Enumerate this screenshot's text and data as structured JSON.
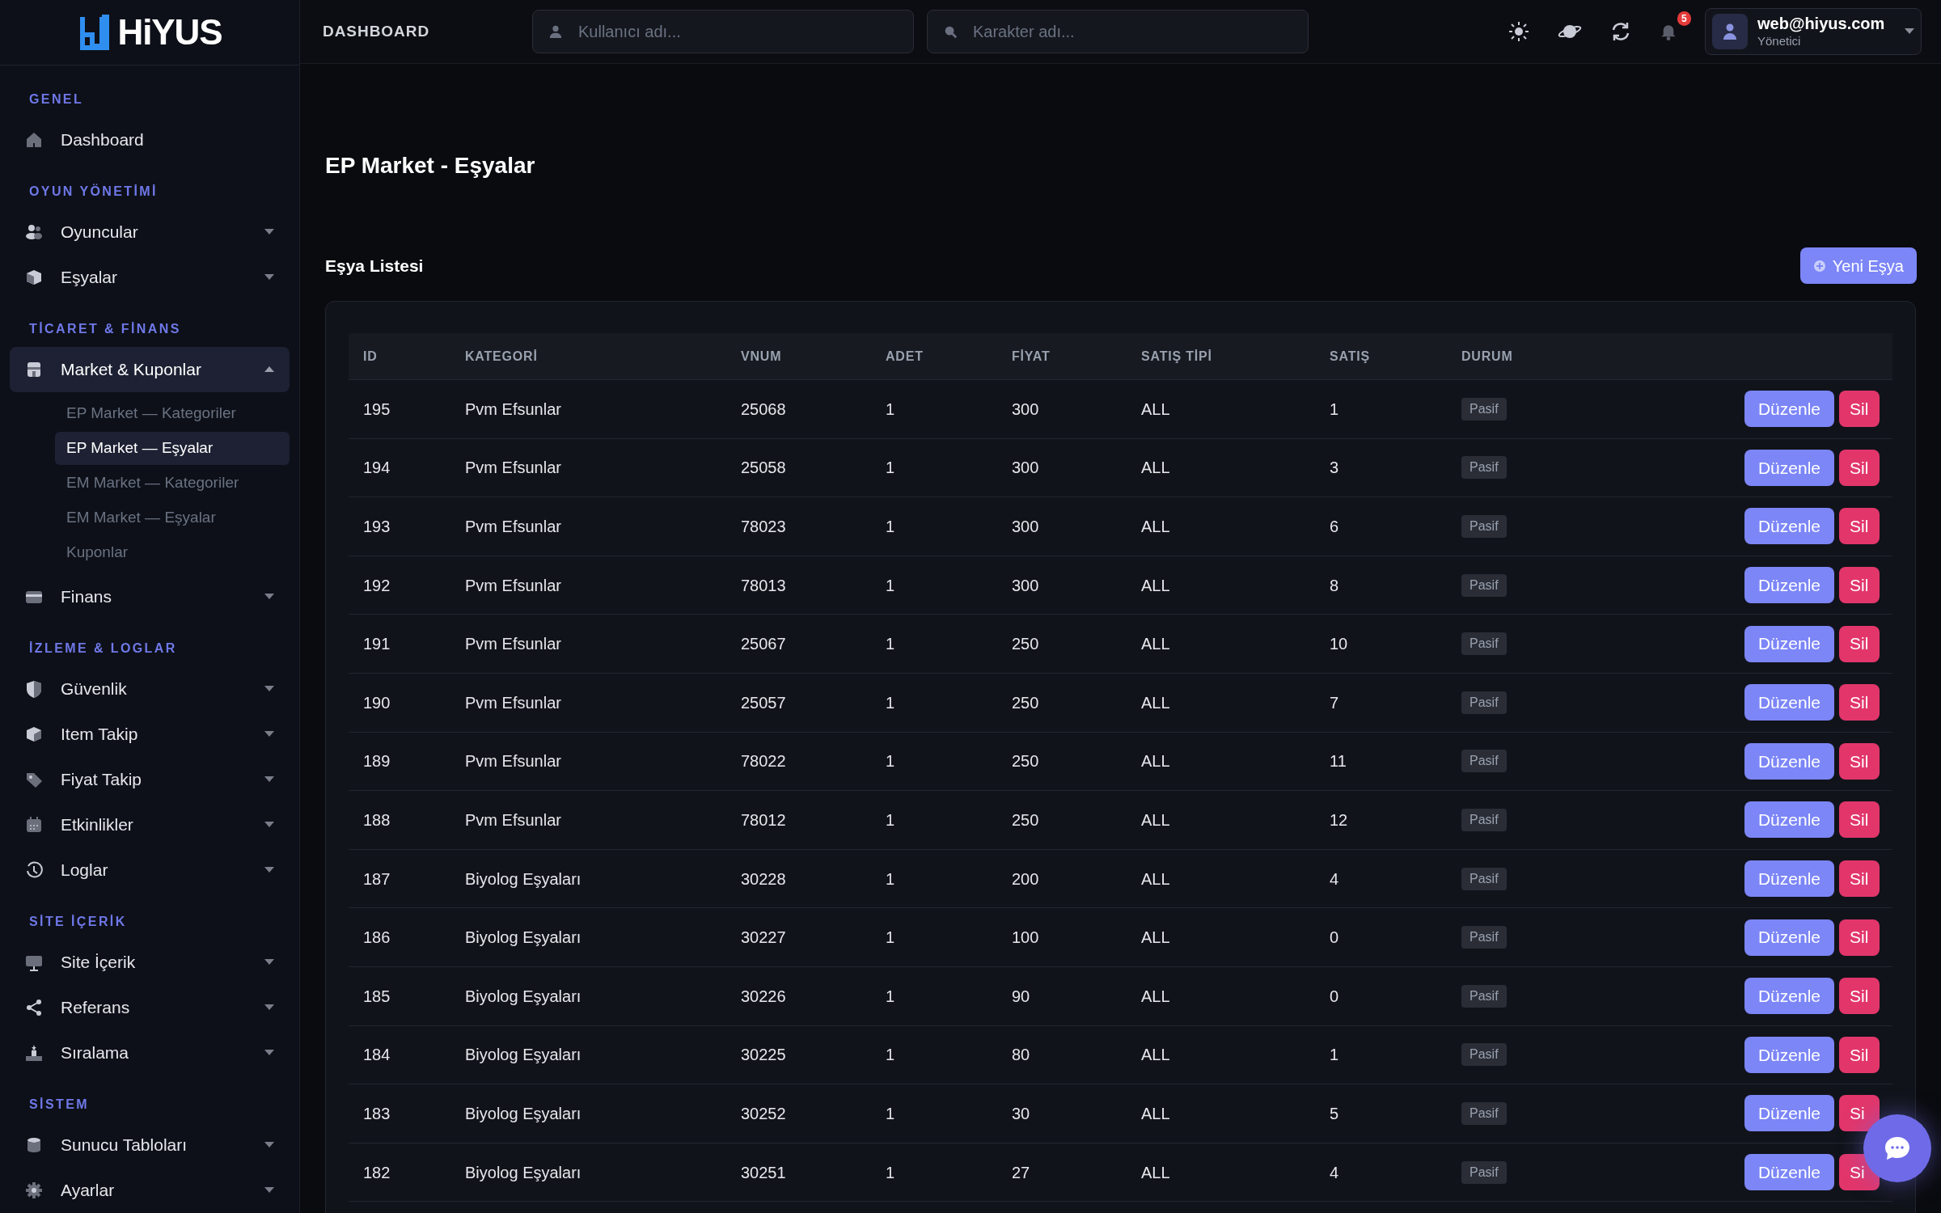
{
  "logo": {
    "text": "HiYUS"
  },
  "topbar": {
    "title": "DASHBOARD",
    "search_user": {
      "placeholder": "Kullanıcı adı..."
    },
    "search_char": {
      "placeholder": "Karakter adı..."
    },
    "notifications": "5",
    "user": {
      "email": "web@hiyus.com",
      "role": "Yönetici"
    }
  },
  "sidebar": [
    {
      "kind": "section",
      "label": "GENEL"
    },
    {
      "kind": "item",
      "label": "Dashboard"
    },
    {
      "kind": "section",
      "label": "OYUN YÖNETİMİ"
    },
    {
      "kind": "item",
      "label": "Oyuncular",
      "expanded": false
    },
    {
      "kind": "item",
      "label": "Eşyalar",
      "expanded": false
    },
    {
      "kind": "section",
      "label": "TİCARET & FİNANS"
    },
    {
      "kind": "item",
      "label": "Market & Kuponlar",
      "expanded": true,
      "selected": true,
      "children": [
        {
          "label": "EP Market — Kategoriler",
          "selected": false
        },
        {
          "label": "EP Market — Eşyalar",
          "selected": true
        },
        {
          "label": "EM Market — Kategoriler",
          "selected": false
        },
        {
          "label": "EM Market — Eşyalar",
          "selected": false
        },
        {
          "label": "Kuponlar",
          "selected": false
        }
      ]
    },
    {
      "kind": "item",
      "label": "Finans",
      "expanded": false
    },
    {
      "kind": "section",
      "label": "İZLEME & LOGLAR"
    },
    {
      "kind": "item",
      "label": "Güvenlik",
      "expanded": false
    },
    {
      "kind": "item",
      "label": "Item Takip",
      "expanded": false
    },
    {
      "kind": "item",
      "label": "Fiyat Takip",
      "expanded": false
    },
    {
      "kind": "item",
      "label": "Etkinlikler",
      "expanded": false
    },
    {
      "kind": "item",
      "label": "Loglar",
      "expanded": false
    },
    {
      "kind": "section",
      "label": "SİTE İÇERİK"
    },
    {
      "kind": "item",
      "label": "Site İçerik",
      "expanded": false
    },
    {
      "kind": "item",
      "label": "Referans",
      "expanded": false
    },
    {
      "kind": "item",
      "label": "Sıralama",
      "expanded": false
    },
    {
      "kind": "section",
      "label": "SİSTEM"
    },
    {
      "kind": "item",
      "label": "Sunucu Tabloları",
      "expanded": false
    },
    {
      "kind": "item",
      "label": "Ayarlar",
      "expanded": false
    }
  ],
  "page_title": "EP Market - Eşyalar",
  "list_title": "Eşya Listesi",
  "new_button": "Yeni Eşya",
  "table": {
    "columns": [
      "ID",
      "KATEGORİ",
      "VNUM",
      "ADET",
      "FİYAT",
      "SATIŞ TİPİ",
      "SATIŞ",
      "DURUM"
    ],
    "rows": [
      {
        "cells": [
          "195",
          "Pvm Efsunlar",
          "25068",
          "1",
          "300",
          "ALL",
          "1",
          "Pasif"
        ],
        "actions": [
          "Düzenle",
          "Sil"
        ]
      },
      {
        "cells": [
          "194",
          "Pvm Efsunlar",
          "25058",
          "1",
          "300",
          "ALL",
          "3",
          "Pasif"
        ],
        "actions": [
          "Düzenle",
          "Sil"
        ]
      },
      {
        "cells": [
          "193",
          "Pvm Efsunlar",
          "78023",
          "1",
          "300",
          "ALL",
          "6",
          "Pasif"
        ],
        "actions": [
          "Düzenle",
          "Sil"
        ]
      },
      {
        "cells": [
          "192",
          "Pvm Efsunlar",
          "78013",
          "1",
          "300",
          "ALL",
          "8",
          "Pasif"
        ],
        "actions": [
          "Düzenle",
          "Sil"
        ]
      },
      {
        "cells": [
          "191",
          "Pvm Efsunlar",
          "25067",
          "1",
          "250",
          "ALL",
          "10",
          "Pasif"
        ],
        "actions": [
          "Düzenle",
          "Sil"
        ]
      },
      {
        "cells": [
          "190",
          "Pvm Efsunlar",
          "25057",
          "1",
          "250",
          "ALL",
          "7",
          "Pasif"
        ],
        "actions": [
          "Düzenle",
          "Sil"
        ]
      },
      {
        "cells": [
          "189",
          "Pvm Efsunlar",
          "78022",
          "1",
          "250",
          "ALL",
          "11",
          "Pasif"
        ],
        "actions": [
          "Düzenle",
          "Sil"
        ]
      },
      {
        "cells": [
          "188",
          "Pvm Efsunlar",
          "78012",
          "1",
          "250",
          "ALL",
          "12",
          "Pasif"
        ],
        "actions": [
          "Düzenle",
          "Sil"
        ]
      },
      {
        "cells": [
          "187",
          "Biyolog Eşyaları",
          "30228",
          "1",
          "200",
          "ALL",
          "4",
          "Pasif"
        ],
        "actions": [
          "Düzenle",
          "Sil"
        ]
      },
      {
        "cells": [
          "186",
          "Biyolog Eşyaları",
          "30227",
          "1",
          "100",
          "ALL",
          "0",
          "Pasif"
        ],
        "actions": [
          "Düzenle",
          "Sil"
        ]
      },
      {
        "cells": [
          "185",
          "Biyolog Eşyaları",
          "30226",
          "1",
          "90",
          "ALL",
          "0",
          "Pasif"
        ],
        "actions": [
          "Düzenle",
          "Sil"
        ]
      },
      {
        "cells": [
          "184",
          "Biyolog Eşyaları",
          "30225",
          "1",
          "80",
          "ALL",
          "1",
          "Pasif"
        ],
        "actions": [
          "Düzenle",
          "Sil"
        ]
      },
      {
        "cells": [
          "183",
          "Biyolog Eşyaları",
          "30252",
          "1",
          "30",
          "ALL",
          "5",
          "Pasif"
        ],
        "actions": [
          "Düzenle",
          "Si"
        ]
      },
      {
        "cells": [
          "182",
          "Biyolog Eşyaları",
          "30251",
          "1",
          "27",
          "ALL",
          "4",
          "Pasif"
        ],
        "actions": [
          "Düzenle",
          "Si"
        ]
      }
    ]
  }
}
